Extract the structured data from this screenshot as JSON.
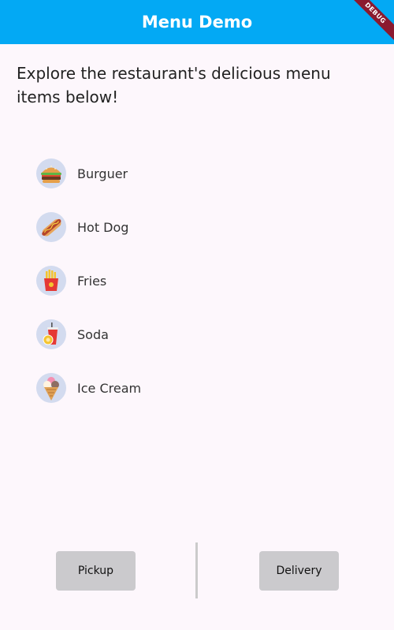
{
  "appbar": {
    "title": "Menu Demo",
    "background": "#03a9f4"
  },
  "debug_banner": "DEBUG",
  "intro": "Explore the restaurant's delicious menu items below!",
  "menu": {
    "items": [
      {
        "label": "Burguer",
        "icon": "burger-icon"
      },
      {
        "label": "Hot Dog",
        "icon": "hot-dog-icon"
      },
      {
        "label": "Fries",
        "icon": "fries-icon"
      },
      {
        "label": "Soda",
        "icon": "soda-icon"
      },
      {
        "label": "Ice Cream",
        "icon": "ice-cream-icon"
      }
    ]
  },
  "actions": {
    "pickup_label": "Pickup",
    "delivery_label": "Delivery"
  }
}
